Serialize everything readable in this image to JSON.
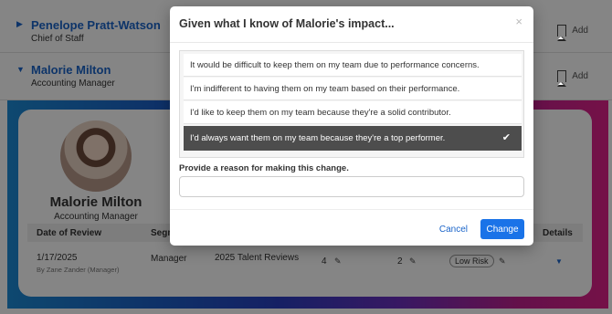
{
  "employees": [
    {
      "name": "Penelope Pratt-Watson",
      "title": "Chief of Staff",
      "add_label": "Add"
    },
    {
      "name": "Malorie Milton",
      "title": "Accounting Manager",
      "add_label": "Add"
    }
  ],
  "profile": {
    "name": "Malorie Milton",
    "title": "Accounting Manager"
  },
  "table": {
    "headers": {
      "date": "Date of Review",
      "segment": "Segm",
      "details": "Details"
    },
    "row": {
      "date": "1/17/2025",
      "by": "By Zane Zander (Manager)",
      "segment": "Manager",
      "review": "2025 Talent Reviews",
      "score1": "4",
      "score2": "2",
      "risk": "Low Risk"
    }
  },
  "modal": {
    "title": "Given what I know of Malorie's impact...",
    "close_glyph": "×",
    "options": [
      {
        "label": "It would be difficult to keep them on my team due to performance concerns.",
        "selected": false
      },
      {
        "label": "I'm indifferent to having them on my team based on their performance.",
        "selected": false
      },
      {
        "label": "I'd like to keep them on my team because they're a solid contributor.",
        "selected": false
      },
      {
        "label": "I'd always want them on my team because they're a top performer.",
        "selected": true
      }
    ],
    "check_glyph": "✔",
    "reason_label": "Provide a reason for making this change.",
    "reason_value": "",
    "cancel_label": "Cancel",
    "change_label": "Change"
  },
  "colors": {
    "accent": "#1a73e8",
    "link": "#1a64c9",
    "selected_option_bg": "#4d4d4d"
  },
  "icons": [
    "caret-right-icon",
    "caret-down-icon",
    "bookmark-icon",
    "pencil-icon",
    "close-icon",
    "checkmark-icon"
  ]
}
